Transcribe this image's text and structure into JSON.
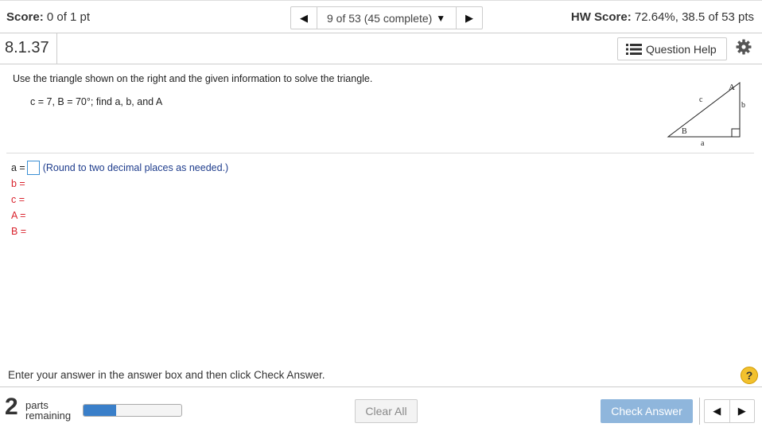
{
  "header": {
    "score_label": "Score:",
    "score_value": "0 of 1 pt",
    "nav_prev_icon": "◀",
    "nav_position": "9 of 53 (45 complete)",
    "nav_caret_icon": "▼",
    "nav_next_icon": "▶",
    "hw_label": "HW Score:",
    "hw_value": "72.64%, 38.5 of 53 pts"
  },
  "question": {
    "number": "8.1.37",
    "help_label": "Question Help",
    "instruction": "Use the triangle shown on the right and the given information to solve the triangle.",
    "given": "c = 7, B = 70°; find a, b, and A",
    "triangle_labels": {
      "A": "A",
      "B": "B",
      "a": "a",
      "b": "b",
      "c": "c"
    }
  },
  "answers": {
    "a_label": "a =",
    "a_value": "",
    "a_hint": "(Round to two decimal places as needed.)",
    "b_label": "b =",
    "c_label": "c =",
    "A_label": "A =",
    "B_label": "B ="
  },
  "footer": {
    "instruction": "Enter your answer in the answer box and then click Check Answer.",
    "help_icon": "?",
    "parts_count": "2",
    "parts_line1": "parts",
    "parts_line2": "remaining",
    "progress_fraction": 0.33,
    "clear_label": "Clear All",
    "check_label": "Check Answer",
    "prev_icon": "◀",
    "next_icon": "▶"
  },
  "colors": {
    "accent_blue": "#3a7fc9",
    "check_button": "#8fb6dc",
    "incomplete_red": "#d9232d",
    "hint_blue": "#1e3c8c",
    "help_yellow": "#f2c12e"
  }
}
